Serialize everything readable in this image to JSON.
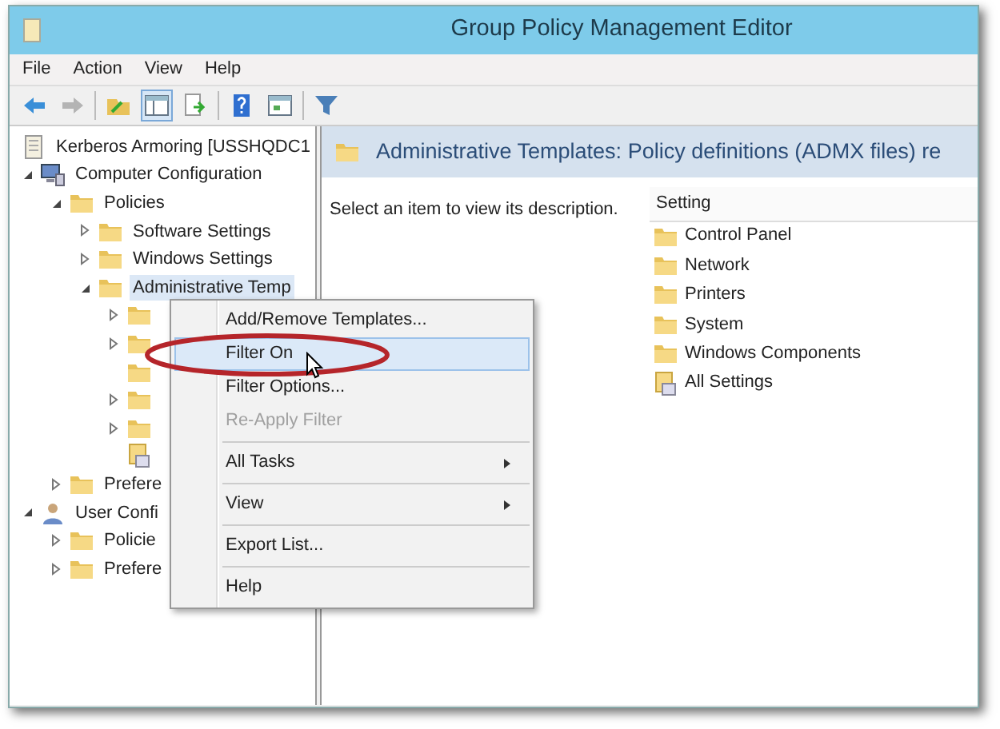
{
  "window": {
    "title": "Group Policy Management Editor"
  },
  "menu_bar": [
    "File",
    "Action",
    "View",
    "Help"
  ],
  "toolbar": [
    {
      "kind": "back",
      "disabled": false,
      "pressed": false
    },
    {
      "kind": "forward",
      "disabled": true,
      "pressed": false
    },
    {
      "kind": "separator"
    },
    {
      "kind": "up",
      "disabled": false,
      "pressed": false
    },
    {
      "kind": "show-tree",
      "disabled": false,
      "pressed": true
    },
    {
      "kind": "export",
      "disabled": false,
      "pressed": false
    },
    {
      "kind": "separator"
    },
    {
      "kind": "help",
      "disabled": false,
      "pressed": false
    },
    {
      "kind": "properties",
      "disabled": false,
      "pressed": false
    },
    {
      "kind": "separator"
    },
    {
      "kind": "filter",
      "disabled": false,
      "pressed": false
    }
  ],
  "tree": [
    {
      "label": "Kerberos Armoring [USSHQDC1",
      "kind": "gpo",
      "selected": false,
      "children": [
        {
          "label": "Computer Configuration",
          "kind": "computer",
          "expanded": true,
          "selected": false,
          "children": [
            {
              "label": "Policies",
              "kind": "folder",
              "expanded": true,
              "selected": false,
              "children": [
                {
                  "label": "Software Settings",
                  "kind": "folder",
                  "expanded": false,
                  "selected": false
                },
                {
                  "label": "Windows Settings",
                  "kind": "folder",
                  "expanded": false,
                  "selected": false
                },
                {
                  "label": "Administrative Temp",
                  "kind": "folder",
                  "expanded": true,
                  "selected": true,
                  "children": [
                    {
                      "kind": "folder",
                      "expanded": false
                    },
                    {
                      "kind": "folder",
                      "expanded": false
                    },
                    {
                      "kind": "folder"
                    },
                    {
                      "kind": "folder",
                      "expanded": false
                    },
                    {
                      "kind": "folder",
                      "expanded": false
                    },
                    {
                      "kind": "settings"
                    }
                  ]
                }
              ]
            },
            {
              "label": "Prefere",
              "kind": "folder",
              "expanded": false,
              "selected": false
            }
          ]
        },
        {
          "label": "User Confi",
          "kind": "user",
          "expanded": true,
          "selected": false,
          "children": [
            {
              "label": "Policie",
              "kind": "folder",
              "expanded": false,
              "selected": false
            },
            {
              "label": "Prefere",
              "kind": "folder",
              "expanded": false,
              "selected": false
            }
          ]
        }
      ]
    }
  ],
  "details": {
    "title": "Administrative Templates: Policy definitions (ADMX files) re",
    "description": "Select an item to view its description.",
    "column": "Setting",
    "items": [
      {
        "label": "Control Panel",
        "kind": "folder"
      },
      {
        "label": "Network",
        "kind": "folder"
      },
      {
        "label": "Printers",
        "kind": "folder"
      },
      {
        "label": "System",
        "kind": "folder"
      },
      {
        "label": "Windows Components",
        "kind": "folder"
      },
      {
        "label": "All Settings",
        "kind": "settings"
      }
    ]
  },
  "context_menu": [
    {
      "kind": "item",
      "label": "Add/Remove Templates...",
      "selected": false,
      "disabled": false,
      "circled": false,
      "cursor": false
    },
    {
      "kind": "item",
      "label": "Filter On",
      "selected": true,
      "disabled": false,
      "circled": true,
      "cursor": true
    },
    {
      "kind": "item",
      "label": "Filter Options...",
      "selected": false,
      "disabled": false,
      "circled": false,
      "cursor": false
    },
    {
      "kind": "item",
      "label": "Re-Apply Filter",
      "selected": false,
      "disabled": true,
      "circled": false,
      "cursor": false
    },
    {
      "kind": "separator"
    },
    {
      "kind": "submenu",
      "label": "All Tasks",
      "selected": false,
      "disabled": false,
      "circled": false,
      "cursor": false
    },
    {
      "kind": "separator"
    },
    {
      "kind": "submenu",
      "label": "View",
      "selected": false,
      "disabled": false,
      "circled": false,
      "cursor": false
    },
    {
      "kind": "separator"
    },
    {
      "kind": "item",
      "label": "Export List...",
      "selected": false,
      "disabled": false,
      "circled": false,
      "cursor": false
    },
    {
      "kind": "separator"
    },
    {
      "kind": "item",
      "label": "Help",
      "selected": false,
      "disabled": false,
      "circled": false,
      "cursor": false
    }
  ]
}
